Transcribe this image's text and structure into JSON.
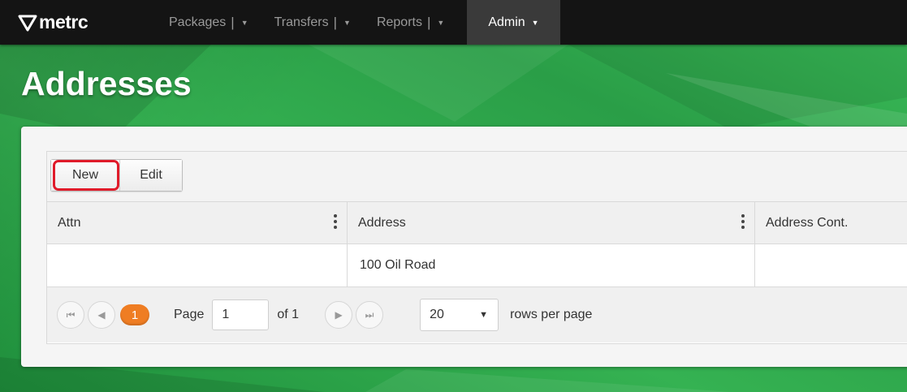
{
  "brand": {
    "name": "metrc"
  },
  "nav": {
    "items": [
      {
        "label": "Packages",
        "sep": "|"
      },
      {
        "label": "Transfers",
        "sep": "|"
      },
      {
        "label": "Reports",
        "sep": "|"
      },
      {
        "label": "Admin"
      }
    ]
  },
  "page": {
    "title": "Addresses"
  },
  "toolbar": {
    "new_label": "New",
    "edit_label": "Edit"
  },
  "table": {
    "columns": [
      "Attn",
      "Address",
      "Address Cont."
    ],
    "rows": [
      {
        "attn": "",
        "address": "100 Oil Road",
        "address_cont": ""
      }
    ]
  },
  "pager": {
    "current_page_badge": "1",
    "page_label": "Page",
    "page_value": "1",
    "of_label": "of 1",
    "rows_per_page_value": "20",
    "rows_per_page_label": "rows per page"
  },
  "colors": {
    "navbar": "#141414",
    "accent_green": "#2aa348",
    "page_badge": "#ef7d23",
    "highlight_red": "#e01b2a"
  }
}
